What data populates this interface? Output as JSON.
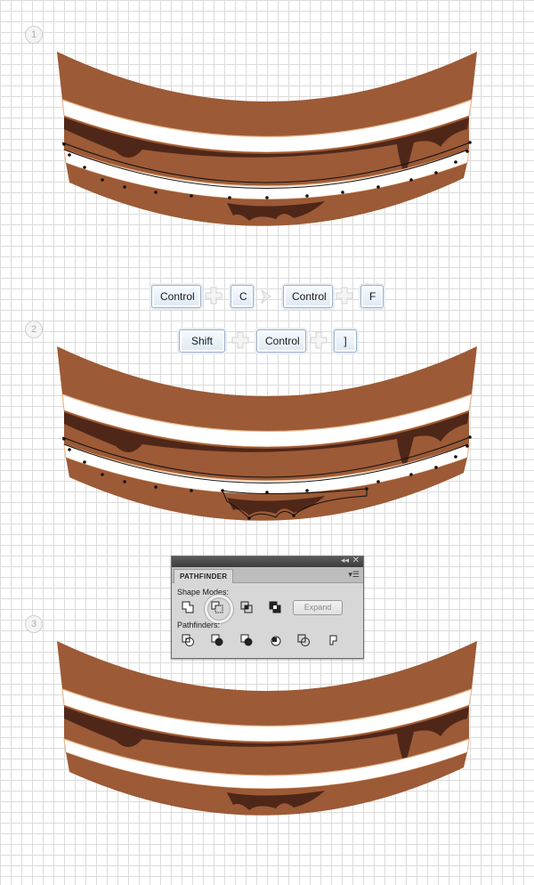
{
  "steps": [
    "1",
    "2",
    "3"
  ],
  "shortcuts": {
    "row1": [
      "Control",
      "C",
      "Control",
      "F"
    ],
    "row2": [
      "Shift",
      "Control",
      "]"
    ]
  },
  "panel": {
    "title": "PATHFINDER",
    "shape_modes_label": "Shape Modes:",
    "pathfinders_label": "Pathfinders:",
    "expand_label": "Expand",
    "collapse_glyph": "◂◂",
    "close_glyph": "✕",
    "menu_glyph": "▾☰"
  },
  "colors": {
    "cake": "#9c5a36",
    "cream": "#ffffff",
    "chocolate": "#4f2719",
    "grid": "#dcdcdc",
    "key_border": "#9fb0c4"
  }
}
